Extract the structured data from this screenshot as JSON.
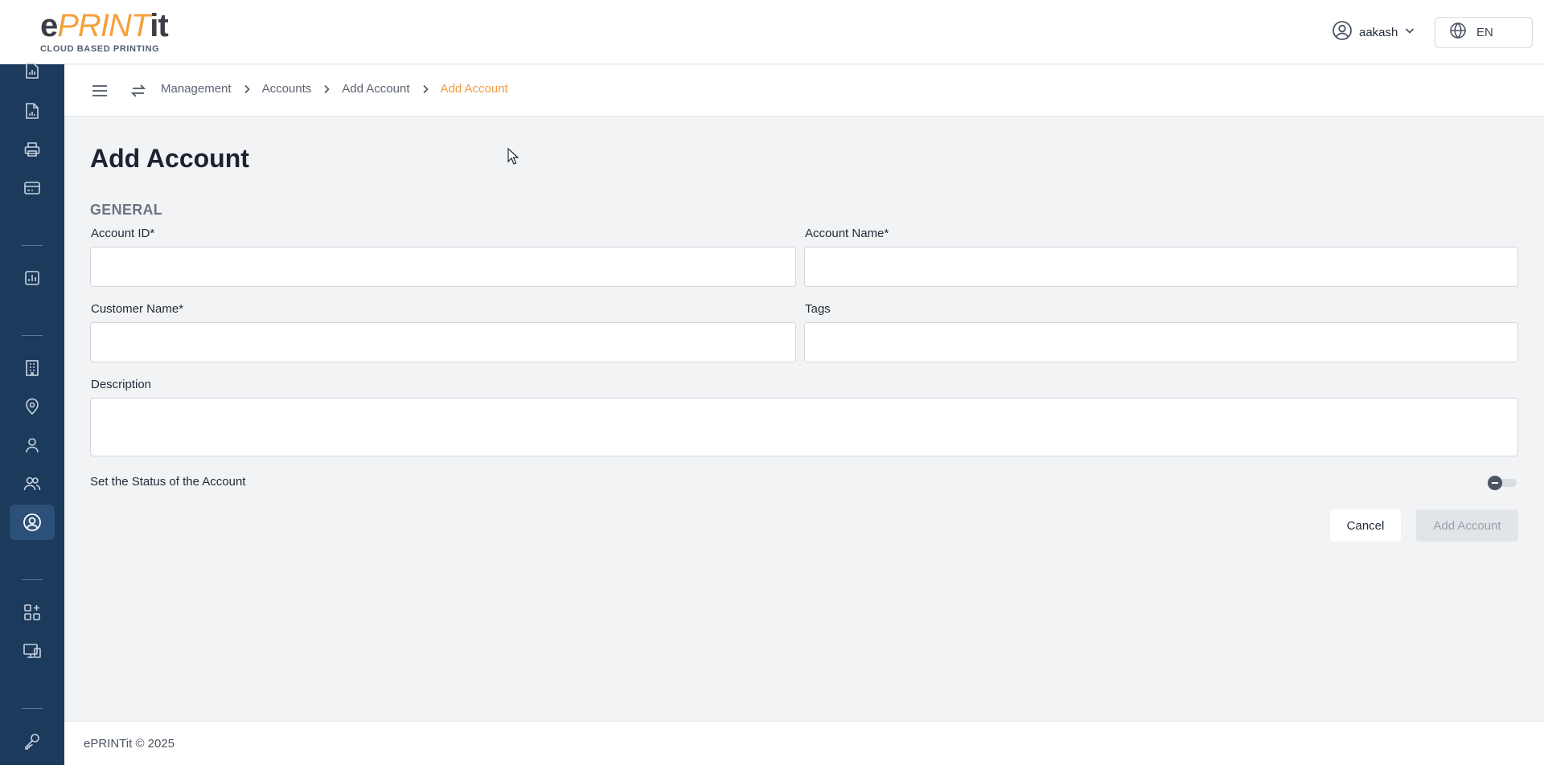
{
  "brand": {
    "logo_e": "e",
    "logo_print": "PRINT",
    "logo_it": "it",
    "tagline": "CLOUD BASED PRINTING",
    "accent_color": "#f4a13a",
    "sidebar_color": "#1b3a5c"
  },
  "header": {
    "user_name": "aakash",
    "user_icon": "user-circle-icon",
    "language": "EN",
    "language_icon": "globe-icon"
  },
  "sidebar": {
    "items": [
      {
        "icon": "report-icon"
      },
      {
        "icon": "document-chart-icon"
      },
      {
        "icon": "printer-icon"
      },
      {
        "icon": "card-icon"
      },
      {
        "icon": "analytics-icon"
      },
      {
        "icon": "building-icon"
      },
      {
        "icon": "location-icon"
      },
      {
        "icon": "user-icon"
      },
      {
        "icon": "users-icon"
      },
      {
        "icon": "account-icon",
        "active": true
      },
      {
        "icon": "apps-icon"
      },
      {
        "icon": "devices-icon"
      },
      {
        "icon": "key-icon"
      }
    ]
  },
  "breadcrumb": {
    "items": [
      "Management",
      "Accounts",
      "Add Account"
    ],
    "current": "Add Account"
  },
  "page": {
    "title": "Add Account",
    "section": "GENERAL"
  },
  "form": {
    "account_id": {
      "label": "Account ID*",
      "value": ""
    },
    "account_name": {
      "label": "Account Name*",
      "value": ""
    },
    "customer_name": {
      "label": "Customer Name*",
      "value": ""
    },
    "tags": {
      "label": "Tags",
      "value": ""
    },
    "description": {
      "label": "Description",
      "value": ""
    },
    "status_label": "Set the Status of the Account",
    "status_on": false
  },
  "actions": {
    "cancel": "Cancel",
    "submit": "Add Account"
  },
  "footer": {
    "copyright": "ePRINTit © 2025"
  }
}
